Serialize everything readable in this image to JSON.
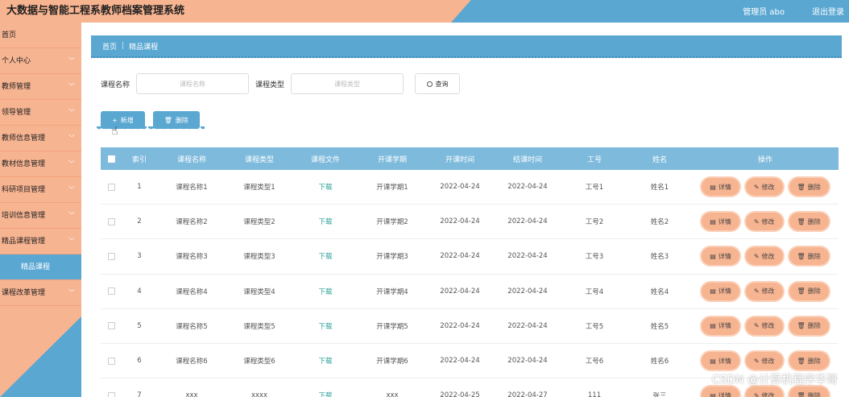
{
  "header": {
    "title": "大数据与智能工程系教师档案管理系统",
    "user": "管理员 abo",
    "logout": "退出登录"
  },
  "sidebar": {
    "items": [
      {
        "label": "首页",
        "expandable": false
      },
      {
        "label": "个人中心",
        "expandable": true
      },
      {
        "label": "教师管理",
        "expandable": true
      },
      {
        "label": "领导管理",
        "expandable": true
      },
      {
        "label": "教师信息管理",
        "expandable": true
      },
      {
        "label": "教材信息管理",
        "expandable": true
      },
      {
        "label": "科研项目管理",
        "expandable": true
      },
      {
        "label": "培训信息管理",
        "expandable": true
      },
      {
        "label": "精品课程管理",
        "expandable": true
      },
      {
        "label": "精品课程",
        "sub": true
      },
      {
        "label": "课程改革管理",
        "expandable": true
      }
    ]
  },
  "breadcrumb": {
    "home": "首页",
    "sep": "|",
    "current": "精品课程"
  },
  "search": {
    "name_label": "课程名称",
    "name_placeholder": "课程名称",
    "type_label": "课程类型",
    "type_placeholder": "课程类型",
    "query_label": "查询"
  },
  "actions": {
    "add": "新增",
    "delete": "删除"
  },
  "table": {
    "headers": [
      "索引",
      "课程名称",
      "课程类型",
      "课程文件",
      "开课学期",
      "开课时间",
      "结课时间",
      "工号",
      "姓名",
      "操作"
    ],
    "rows": [
      [
        "1",
        "课程名称1",
        "课程类型1",
        "下载",
        "开课学期1",
        "2022-04-24",
        "2022-04-24",
        "工号1",
        "姓名1"
      ],
      [
        "2",
        "课程名称2",
        "课程类型2",
        "下载",
        "开课学期2",
        "2022-04-24",
        "2022-04-24",
        "工号2",
        "姓名2"
      ],
      [
        "3",
        "课程名称3",
        "课程类型3",
        "下载",
        "开课学期3",
        "2022-04-24",
        "2022-04-24",
        "工号3",
        "姓名3"
      ],
      [
        "4",
        "课程名称4",
        "课程类型4",
        "下载",
        "开课学期4",
        "2022-04-24",
        "2022-04-24",
        "工号4",
        "姓名4"
      ],
      [
        "5",
        "课程名称5",
        "课程类型5",
        "下载",
        "开课学期5",
        "2022-04-24",
        "2022-04-24",
        "工号5",
        "姓名5"
      ],
      [
        "6",
        "课程名称6",
        "课程类型6",
        "下载",
        "开课学期6",
        "2022-04-24",
        "2022-04-24",
        "工号6",
        "姓名6"
      ],
      [
        "7",
        "xxx",
        "xxxx",
        "下载",
        "xxx",
        "2022-04-25",
        "2022-04-27",
        "111",
        "张三"
      ]
    ],
    "ops": {
      "detail": "详情",
      "edit": "修改",
      "delete": "删除"
    }
  },
  "watermark": "CSDN @计算机程序华哥",
  "colors": {
    "orange": "#f7b491",
    "blue": "#5aa7d2",
    "header_blue": "#7dbadc"
  }
}
